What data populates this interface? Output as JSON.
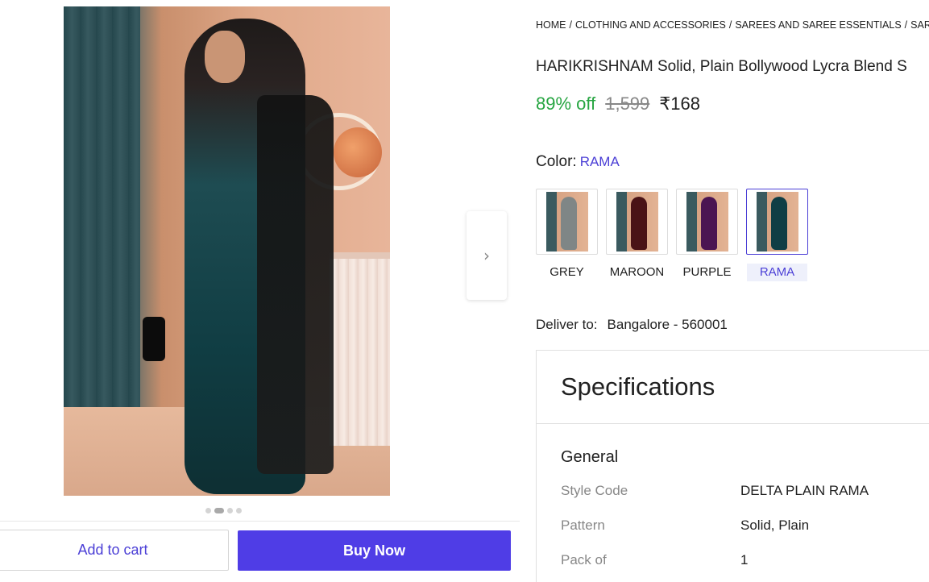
{
  "breadcrumb": [
    "HOME",
    "CLOTHING AND ACCESSORIES",
    "SAREES AND SAREE ESSENTIALS",
    "SARE"
  ],
  "product": {
    "title": "HARIKRISHNAM Solid, Plain Bollywood Lycra Blend S",
    "discount": "89% off",
    "mrp": "1,599",
    "price": "₹168"
  },
  "color": {
    "label": "Color:",
    "selected": "RAMA",
    "options": [
      {
        "name": "GREY",
        "tone": "#7f8686"
      },
      {
        "name": "MAROON",
        "tone": "#4a1316"
      },
      {
        "name": "PURPLE",
        "tone": "#4b1552"
      },
      {
        "name": "RAMA",
        "tone": "#0f3e45"
      }
    ]
  },
  "delivery": {
    "label": "Deliver to:",
    "location": "Bangalore - 560001"
  },
  "specifications": {
    "title": "Specifications",
    "section": "General",
    "rows": [
      {
        "key": "Style Code",
        "value": "DELTA PLAIN RAMA"
      },
      {
        "key": "Pattern",
        "value": "Solid, Plain"
      },
      {
        "key": "Pack of",
        "value": "1"
      }
    ]
  },
  "gallery": {
    "next_icon": "chevron-right-icon",
    "slide_count": 4,
    "active_slide": 2
  },
  "actions": {
    "add_to_cart": "Add to cart",
    "buy_now": "Buy Now"
  },
  "colors": {
    "accent": "#4f3de6",
    "discount_green": "#26a541",
    "muted": "#878787"
  }
}
